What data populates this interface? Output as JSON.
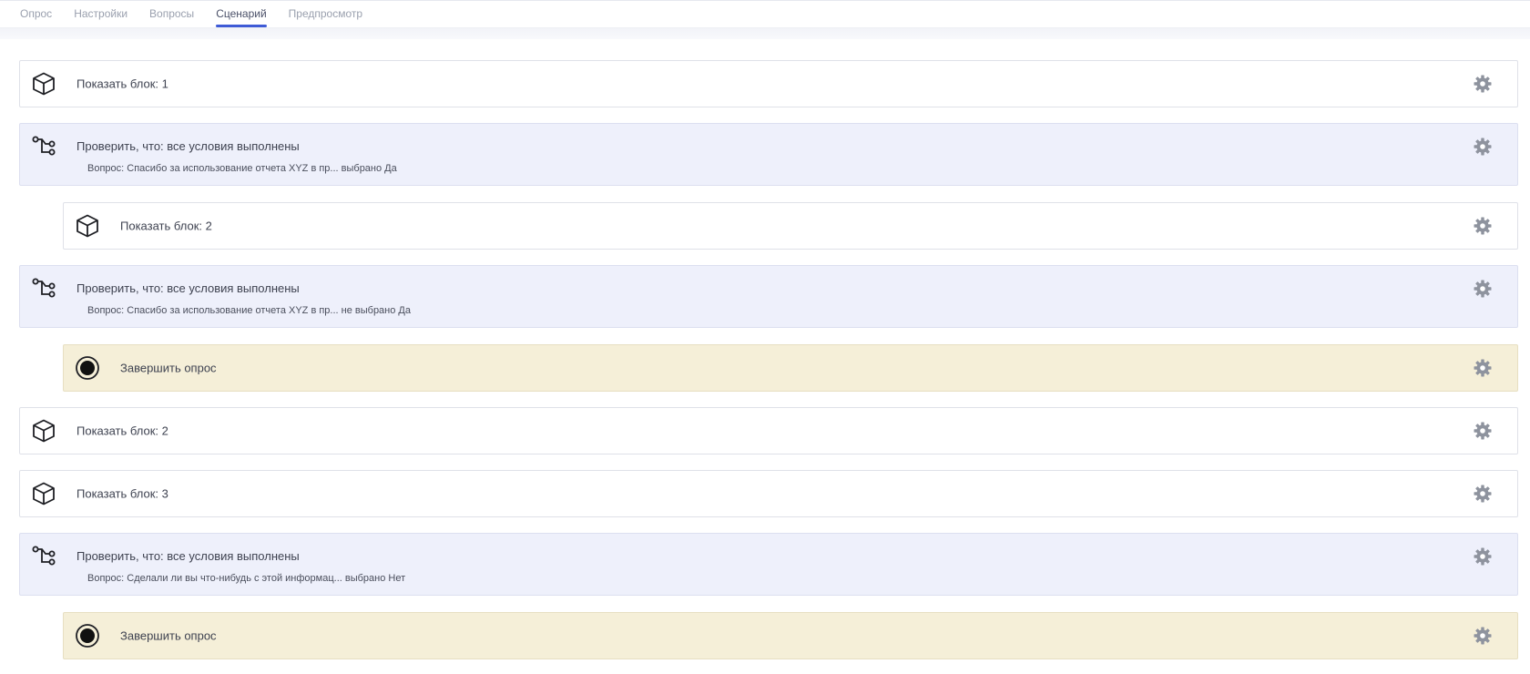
{
  "tabs": [
    {
      "label": "Опрос",
      "active": false
    },
    {
      "label": "Настройки",
      "active": false
    },
    {
      "label": "Вопросы",
      "active": false
    },
    {
      "label": "Сценарий",
      "active": true
    },
    {
      "label": "Предпросмотр",
      "active": false
    }
  ],
  "scenario": {
    "steps": [
      {
        "type": "block",
        "icon": "cube-icon",
        "label": "Показать блок: 1",
        "indent": 0
      },
      {
        "type": "condition",
        "icon": "branch-icon",
        "label": "Проверить, что: все условия выполнены",
        "detail": "Вопрос: Спасибо за использование отчета XYZ в пр... выбрано Да",
        "indent": 0
      },
      {
        "type": "block",
        "icon": "cube-icon",
        "label": "Показать блок: 2",
        "indent": 1
      },
      {
        "type": "condition",
        "icon": "branch-icon",
        "label": "Проверить, что: все условия выполнены",
        "detail": "Вопрос: Спасибо за использование отчета XYZ в пр... не выбрано Да",
        "indent": 0
      },
      {
        "type": "finish",
        "icon": "stop-circle-icon",
        "label": "Завершить опрос",
        "indent": 1
      },
      {
        "type": "block",
        "icon": "cube-icon",
        "label": "Показать блок: 2",
        "indent": 0
      },
      {
        "type": "block",
        "icon": "cube-icon",
        "label": "Показать блок: 3",
        "indent": 0
      },
      {
        "type": "condition",
        "icon": "branch-icon",
        "label": "Проверить, что: все условия выполнены",
        "detail": "Вопрос: Сделали ли вы что-нибудь с этой информац... выбрано Нет",
        "indent": 0
      },
      {
        "type": "finish",
        "icon": "stop-circle-icon",
        "label": "Завершить опрос",
        "indent": 1
      }
    ]
  },
  "colors": {
    "accent": "#3f5bd6",
    "condition_bg": "#eef0fb",
    "finish_bg": "#f5efd8",
    "block_bg": "#ffffff",
    "gear": "#8e939e"
  }
}
